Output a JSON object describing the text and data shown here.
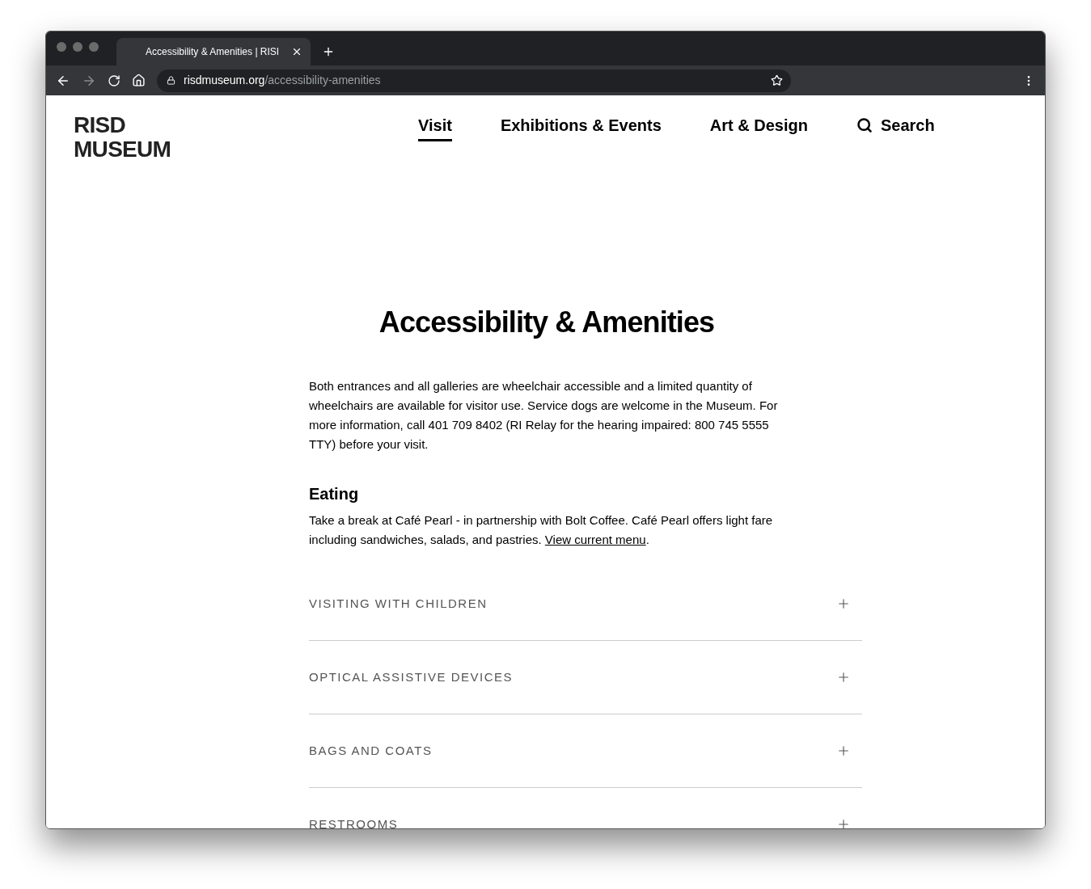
{
  "browser": {
    "tab_title": "Accessibility & Amenities | RISI",
    "url_host": "risdmuseum.org",
    "url_path": "/accessibility-amenities"
  },
  "site": {
    "logo": [
      "RISD",
      "MUSEUM"
    ],
    "nav": [
      {
        "label": "Visit",
        "selected": true
      },
      {
        "label": "Exhibitions & Events",
        "selected": false
      },
      {
        "label": "Art & Design",
        "selected": false
      }
    ],
    "search": "Search"
  },
  "page": {
    "title": "Accessibility & Amenities",
    "intro": "Both entrances and all galleries are wheelchair accessible and a limited quantity of wheelchairs are available for visitor use. Service dogs are welcome in the Museum. For more information, call 401 709 8402 (RI Relay for the hearing impaired: 800 745 5555 TTY) before your visit.",
    "eating": {
      "heading": "Eating",
      "text": "Take a break at Café Pearl - in partnership with Bolt Coffee. Café Pearl offers light fare including sandwiches, salads, and pastries.",
      "link": "View current menu",
      "after_link": "."
    },
    "accordion": [
      {
        "label": "VISITING WITH CHILDREN",
        "expanded": false
      },
      {
        "label": "OPTICAL ASSISTIVE DEVICES",
        "expanded": false
      },
      {
        "label": "BAGS AND COATS",
        "expanded": false
      },
      {
        "label": "RESTROOMS",
        "expanded": false
      }
    ]
  }
}
